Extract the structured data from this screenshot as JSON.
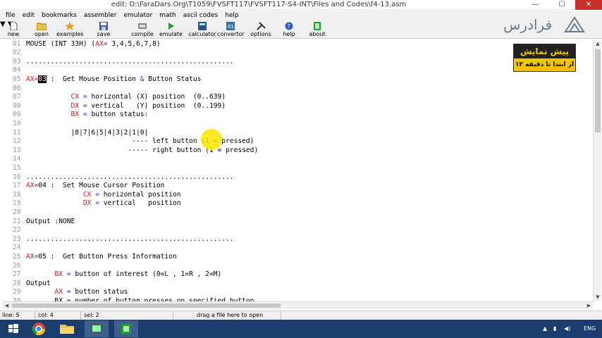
{
  "window": {
    "title": "edit: D:\\FaraDars.Org\\T1059\\FVSFT117\\FVSFT117-S4-INT\\Files and Codes\\f4-13.asm",
    "minimize": "—",
    "maximize": "☐",
    "close": "✕"
  },
  "menu": [
    "file",
    "edit",
    "bookmarks",
    "assembler",
    "emulator",
    "math",
    "ascii codes",
    "help"
  ],
  "toolbar": {
    "new": "new",
    "open": "open",
    "examples": "examples",
    "save": "save",
    "compile": "compile",
    "emulate": "emulate",
    "calculator": "calculator",
    "convertor": "convertor",
    "options": "options",
    "help": "help",
    "about": "about"
  },
  "editor": {
    "lines": [
      {
        "n": "01",
        "code": "MOUSE (INT 33H) (AX= 3,4,5,6,7,8)"
      },
      {
        "n": "02",
        "code": ""
      },
      {
        "n": "03",
        "code": "..................................................."
      },
      {
        "n": "04",
        "code": ""
      },
      {
        "n": "05",
        "pre": "AX=",
        "sel": "03",
        "post": " :  Get Mouse Position & Button Status"
      },
      {
        "n": "06",
        "code": ""
      },
      {
        "n": "07",
        "indent": "           ",
        "reg": "CX",
        "rest": " = horizontal (X) position  (0..639)"
      },
      {
        "n": "08",
        "indent": "           ",
        "reg": "DX",
        "rest": " = vertical   (Y) position  (0..199)"
      },
      {
        "n": "09",
        "indent": "           ",
        "reg": "BX",
        "rest": " = button status:"
      },
      {
        "n": "10",
        "code": ""
      },
      {
        "n": "11",
        "code": "           |8|7|6|5|4|3|2|1|0|"
      },
      {
        "n": "12",
        "code": "                          ---- left button (1 = pressed)"
      },
      {
        "n": "13",
        "code": "                         ----- right button (1 = pressed)"
      },
      {
        "n": "14",
        "code": ""
      },
      {
        "n": "15",
        "code": ""
      },
      {
        "n": "16",
        "code": "..................................................."
      },
      {
        "n": "17",
        "pre2": "AX=04",
        "post2": " :  Set Mouse Cursor Position"
      },
      {
        "n": "18",
        "indent": "              ",
        "reg": "CX",
        "rest": " = horizontal position"
      },
      {
        "n": "19",
        "indent": "              ",
        "reg": "DX",
        "rest": " = vertical   position"
      },
      {
        "n": "20",
        "code": ""
      },
      {
        "n": "21",
        "code": "Output :NONE"
      },
      {
        "n": "22",
        "code": ""
      },
      {
        "n": "23",
        "code": "..................................................."
      },
      {
        "n": "24",
        "code": ""
      },
      {
        "n": "25",
        "pre2": "AX=05",
        "post2": " :  Get Button Press Information"
      },
      {
        "n": "26",
        "code": ""
      },
      {
        "n": "27",
        "indent": "       ",
        "reg": "BX",
        "rest": " = button of interest (0=L , 1=R , 2=M)"
      },
      {
        "n": "28",
        "code": "Output"
      },
      {
        "n": "29",
        "indent": "       ",
        "reg": "AX",
        "rest": " = button status"
      },
      {
        "n": "30",
        "code": "       BX = number of button presses on specified button"
      }
    ]
  },
  "status": {
    "line": "line: 5",
    "col": "col: 4",
    "sel": "sel: 2",
    "drag": "drag a file here to open"
  },
  "taskbar": {
    "lang": "ENG"
  },
  "brand": {
    "logo": "فرادرس",
    "promo_title": "پیش نمایش",
    "promo_sub": "از ابتدا تا دقیقه ۱۳"
  },
  "colors": {
    "register": "#c0201c",
    "operator": "#2a2ad8",
    "taskbar": "#1b3d6e",
    "promo": "#f4c400"
  }
}
